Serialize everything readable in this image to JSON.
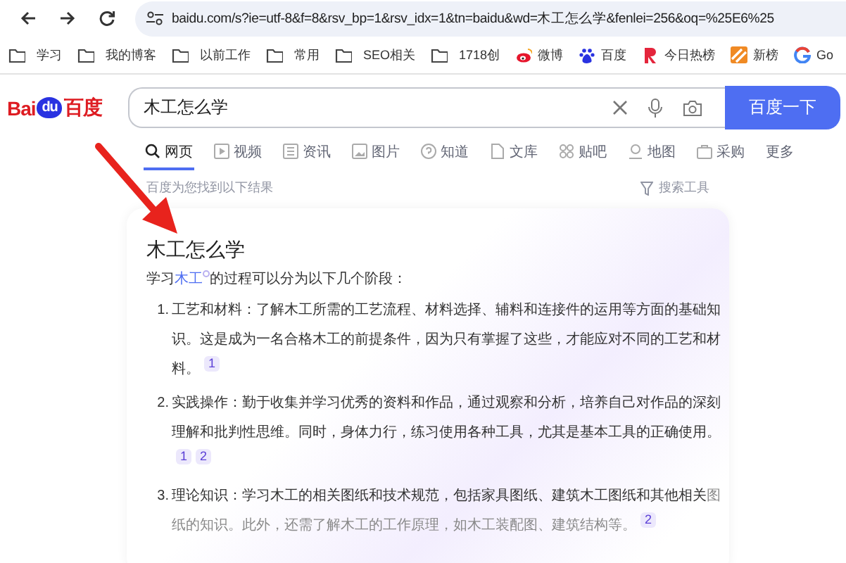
{
  "address_bar": {
    "url": "baidu.com/s?ie=utf-8&f=8&rsv_bp=1&rsv_idx=1&tn=baidu&wd=木工怎么学&fenlei=256&oq=%25E6%25"
  },
  "bookmarks": [
    {
      "kind": "folder",
      "label": "学习"
    },
    {
      "kind": "folder",
      "label": "我的博客"
    },
    {
      "kind": "folder",
      "label": "以前工作"
    },
    {
      "kind": "folder",
      "label": "常用"
    },
    {
      "kind": "folder",
      "label": "SEO相关"
    },
    {
      "kind": "folder",
      "label": "1718创"
    },
    {
      "kind": "weibo",
      "label": "微博"
    },
    {
      "kind": "paw",
      "label": "百度"
    },
    {
      "kind": "letter-r",
      "label": "今日热榜"
    },
    {
      "kind": "stripes",
      "label": "新榜"
    },
    {
      "kind": "letter-g",
      "label": "Go"
    }
  ],
  "search": {
    "logo_left": "Bai",
    "logo_mid": "du",
    "logo_right": "百度",
    "query": "木工怎么学",
    "button": "百度一下"
  },
  "tabs": [
    {
      "label": "网页",
      "selected": true
    },
    {
      "label": "视频",
      "selected": false
    },
    {
      "label": "资讯",
      "selected": false
    },
    {
      "label": "图片",
      "selected": false
    },
    {
      "label": "知道",
      "selected": false
    },
    {
      "label": "文库",
      "selected": false
    },
    {
      "label": "贴吧",
      "selected": false
    },
    {
      "label": "地图",
      "selected": false
    },
    {
      "label": "采购",
      "selected": false
    },
    {
      "label": "更多",
      "selected": false
    }
  ],
  "result_info": "百度为您找到以下结果",
  "search_tools": "搜索工具",
  "answer": {
    "title": "木工怎么学",
    "intro": {
      "before": "学习",
      "link": "木工",
      "after": "的过程可以分为以下几个阶段："
    },
    "items": [
      {
        "number": "1.",
        "text": "工艺和材料：了解木工所需的工艺流程、材料选择、辅料和连接件的运用等方面的基础知识。这是成为一名合格木工的前提条件，因为只有掌握了这些，才能应对不同的工艺和材料。",
        "refs": [
          "1"
        ]
      },
      {
        "number": "2.",
        "text": "实践操作：勤于收集并学习优秀的资料和作品，通过观察和分析，培养自己对作品的深刻理解和批判性思维。同时，身体力行，练习使用各种工具，尤其是基本工具的正确使用。",
        "refs": [
          "1",
          "2"
        ]
      },
      {
        "number": "3.",
        "text": "理论知识：学习木工的相关图纸和技术规范，包括家具图纸、建筑木工图纸和其他相关",
        "faded_text": "图纸的知识。此外，还需了解木工的工作原理，如木工装配图、建筑结构等。",
        "refs": [
          "2"
        ]
      }
    ]
  }
}
